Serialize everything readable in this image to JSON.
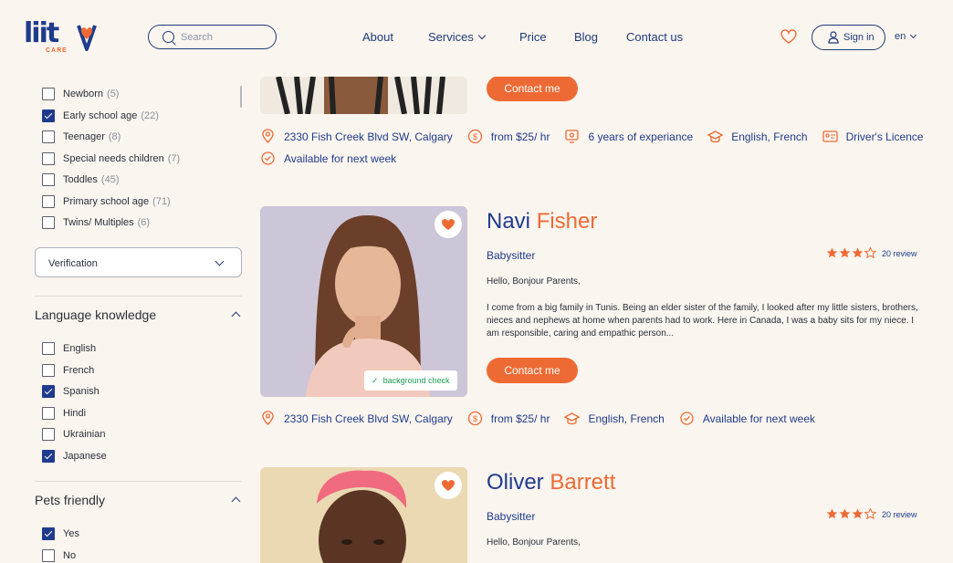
{
  "header": {
    "logo": {
      "text": "liit",
      "sub": "CARE"
    },
    "search": {
      "placeholder": "Search"
    },
    "nav": [
      {
        "label": "About"
      },
      {
        "label": "Services"
      },
      {
        "label": "Price"
      },
      {
        "label": "Blog"
      },
      {
        "label": "Contact us"
      }
    ],
    "sign_in": "Sign in",
    "language": "en"
  },
  "sidebar": {
    "age_options": [
      {
        "label": "Newborn",
        "count": "(5)",
        "checked": false
      },
      {
        "label": "Early school age",
        "count": "(22)",
        "checked": true
      },
      {
        "label": "Teenager",
        "count": "(8)",
        "checked": false
      },
      {
        "label": "Special needs children",
        "count": "(7)",
        "checked": false
      },
      {
        "label": "Toddles",
        "count": "(45)",
        "checked": false
      },
      {
        "label": "Primary school age",
        "count": "(71)",
        "checked": false
      },
      {
        "label": "Twins/ Multiples",
        "count": "(6)",
        "checked": false
      }
    ],
    "verification_select": "Verification",
    "language_section": {
      "title": "Language knowledge",
      "options": [
        {
          "label": "English",
          "checked": false
        },
        {
          "label": "French",
          "checked": false
        },
        {
          "label": "Spanish",
          "checked": true
        },
        {
          "label": "Hindi",
          "checked": false
        },
        {
          "label": "Ukrainian",
          "checked": false
        },
        {
          "label": "Japanese",
          "checked": true
        }
      ]
    },
    "pets_section": {
      "title": "Pets friendly",
      "options": [
        {
          "label": "Yes",
          "checked": true
        },
        {
          "label": "No",
          "checked": false
        }
      ]
    }
  },
  "cards": [
    {
      "contact_label": "Contact me",
      "info": {
        "address": "2330 Fish Creek Blvd SW, Calgary",
        "rate": "from $25/ hr",
        "experience": "6 years of experiance",
        "languages": "English, French",
        "license": "Driver's Licence",
        "availability": "Available for next week"
      }
    },
    {
      "first_name": "Navi",
      "last_name": "Fisher",
      "role": "Babysitter",
      "rating": 3,
      "rating_max": 4,
      "reviews": "20 review",
      "greeting": "Hello, Bonjour Parents,",
      "bio": "I come from a big family in Tunis. Being an elder sister of the family, I looked after my little sisters, brothers, nieces and nephews at home when parents had to work. Here in Canada, I was a baby sits for my niece. I am responsible, caring and empathic person...",
      "badge": "background check",
      "contact_label": "Contact me",
      "info": {
        "address": "2330 Fish Creek Blvd SW, Calgary",
        "rate": "from $25/ hr",
        "languages": "English, French",
        "availability": "Available for next week"
      }
    },
    {
      "first_name": "Oliver",
      "last_name": "Barrett",
      "role": "Babysitter",
      "rating": 3,
      "rating_max": 4,
      "reviews": "20 review",
      "greeting": "Hello, Bonjour Parents,"
    }
  ],
  "colors": {
    "brand_blue": "#1f3b8c",
    "accent_orange": "#ee6a35",
    "background": "#faf5ee",
    "check_green": "#1f9d55"
  }
}
